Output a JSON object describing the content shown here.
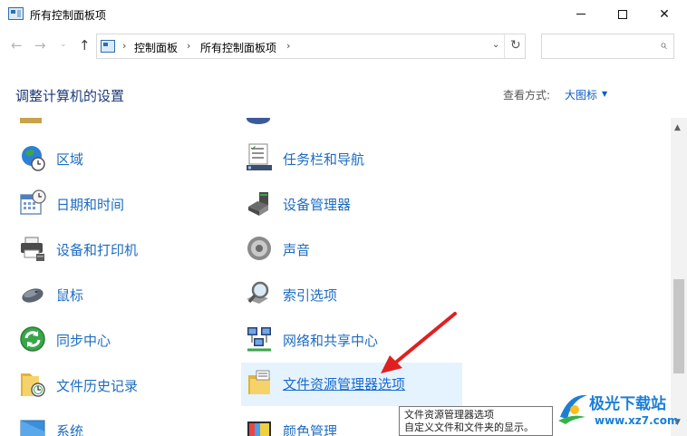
{
  "window": {
    "title": "所有控制面板项",
    "close_glyph": "✕"
  },
  "nav": {
    "back_glyph": "←",
    "forward_glyph": "→",
    "recent_glyph": "⌄",
    "up_glyph": "↑"
  },
  "address": {
    "sep1": "›",
    "crumb1": "控制面板",
    "sep2": "›",
    "crumb2": "所有控制面板项",
    "sep3": "›",
    "dropdown_glyph": "⌄",
    "refresh_glyph": "↻"
  },
  "search": {
    "placeholder": "",
    "icon": "search-icon",
    "glyph": "⌕"
  },
  "header": {
    "title": "调整计算机的设置",
    "view_label": "查看方式:",
    "view_value": "大图标",
    "view_arrow": "▼"
  },
  "items": {
    "left": [
      {
        "label": "区域",
        "icon": "globe-clock-icon"
      },
      {
        "label": "日期和时间",
        "icon": "calendar-clock-icon"
      },
      {
        "label": "设备和打印机",
        "icon": "printer-icon"
      },
      {
        "label": "鼠标",
        "icon": "mouse-icon"
      },
      {
        "label": "同步中心",
        "icon": "sync-icon"
      },
      {
        "label": "文件历史记录",
        "icon": "folder-clock-icon"
      },
      {
        "label": "系统",
        "icon": "computer-icon"
      }
    ],
    "right": [
      {
        "label": "任务栏和导航",
        "icon": "taskbar-icon"
      },
      {
        "label": "设备管理器",
        "icon": "device-manager-icon"
      },
      {
        "label": "声音",
        "icon": "speaker-icon"
      },
      {
        "label": "索引选项",
        "icon": "index-search-icon"
      },
      {
        "label": "网络和共享中心",
        "icon": "network-icon"
      },
      {
        "label": "文件资源管理器选项",
        "icon": "folder-options-icon"
      },
      {
        "label": "颜色管理",
        "icon": "color-management-icon"
      }
    ]
  },
  "scrollbar": {
    "up_glyph": "▲",
    "down_glyph": "▼"
  },
  "tooltip": {
    "line1": "文件资源管理器选项",
    "line2": "自定义文件和文件夹的显示。"
  },
  "watermark": {
    "name": "极光下载站",
    "url": "www.xz7.com"
  },
  "colors": {
    "link": "#1e6cc0",
    "header": "#1e3a78",
    "highlight": "#e5f3ff",
    "annotation": "#e02020"
  }
}
